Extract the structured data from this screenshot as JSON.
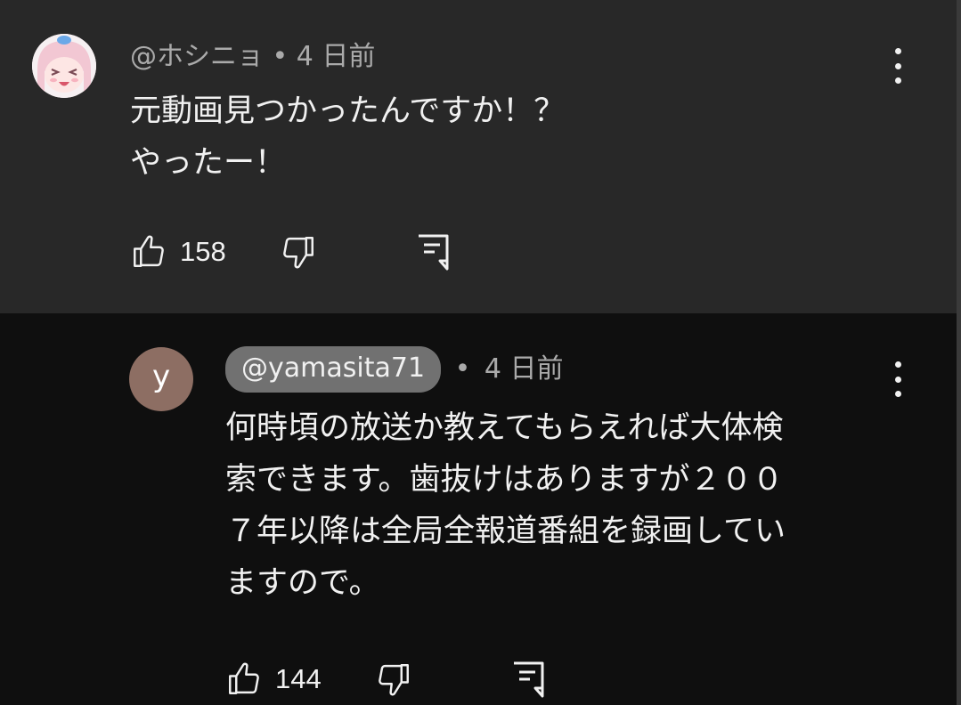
{
  "comment": {
    "handle": "@ホシニョ",
    "separator": "•",
    "time": "4 日前",
    "text_lines": [
      "元動画見つかったんですか！？",
      "やったー！"
    ],
    "like_count": "158",
    "avatar_icon": "anime-girl-avatar-icon"
  },
  "reply": {
    "avatar_letter": "y",
    "avatar_color": "#8d6e63",
    "handle": "@yamasita71",
    "separator": "•",
    "time": "4 日前",
    "text_lines": [
      "何時頃の放送か教えてもらえれば大体検",
      "索できます。歯抜けはありますが２００",
      "７年以降は全局全報道番組を録画してい",
      "ますので。"
    ],
    "like_count": "144"
  },
  "colors": {
    "comment_bg": "#282828",
    "page_bg": "#0f0f0f",
    "meta_text": "#aaaaaa",
    "handle_pill": "#717171"
  }
}
